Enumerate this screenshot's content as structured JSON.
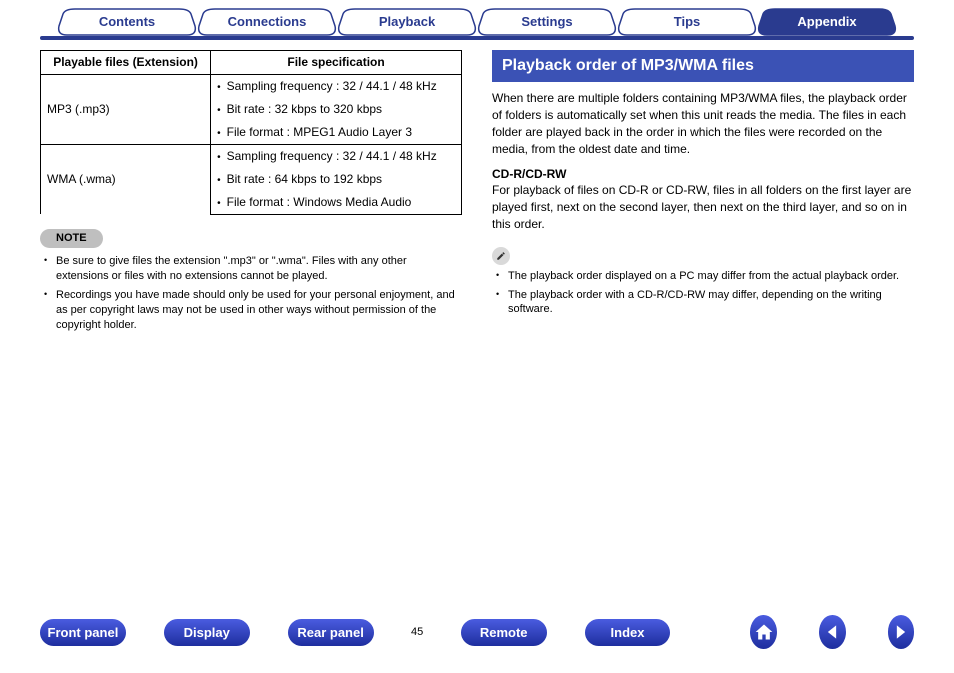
{
  "tabs": {
    "t0": "Contents",
    "t1": "Connections",
    "t2": "Playback",
    "t3": "Settings",
    "t4": "Tips",
    "t5": "Appendix"
  },
  "table": {
    "h1": "Playable files (Extension)",
    "h2": "File specification",
    "r1c1": "MP3 (.mp3)",
    "r1a": "Sampling frequency : 32 / 44.1 / 48 kHz",
    "r1b": "Bit rate : 32 kbps to 320 kbps",
    "r1c": "File format : MPEG1 Audio Layer 3",
    "r2c1": "WMA (.wma)",
    "r2a": "Sampling frequency : 32 / 44.1 / 48 kHz",
    "r2b": "Bit rate : 64 kbps to 192 kbps",
    "r2c": "File format : Windows Media Audio"
  },
  "note": {
    "label": "NOTE",
    "n1": "Be sure to give files the extension \".mp3\" or \".wma\". Files with any other extensions or files with no extensions cannot be played.",
    "n2": "Recordings you have made should only be used for your personal enjoyment, and as per copyright laws may not be used in other ways without permission of the copyright holder."
  },
  "right": {
    "heading": "Playback order of MP3/WMA files",
    "p1": "When there are multiple folders containing MP3/WMA files, the playback order of folders is automatically set when this unit reads the media. The files in each folder are played back in the order in which the files were recorded on the media, from the oldest date and time.",
    "sub": "CD-R/CD-RW",
    "p2": "For playback of files on CD-R or CD-RW, files in all folders on the first layer are played first, next on the second layer, then next on the third layer, and so on in this order.",
    "b1": "The playback order displayed on a PC may differ from the actual playback order.",
    "b2": "The playback order with a CD-R/CD-RW may differ, depending on the writing software."
  },
  "bottom": {
    "b1": "Front panel",
    "b2": "Display",
    "b3": "Rear panel",
    "b4": "Remote",
    "b5": "Index"
  },
  "page": "45"
}
